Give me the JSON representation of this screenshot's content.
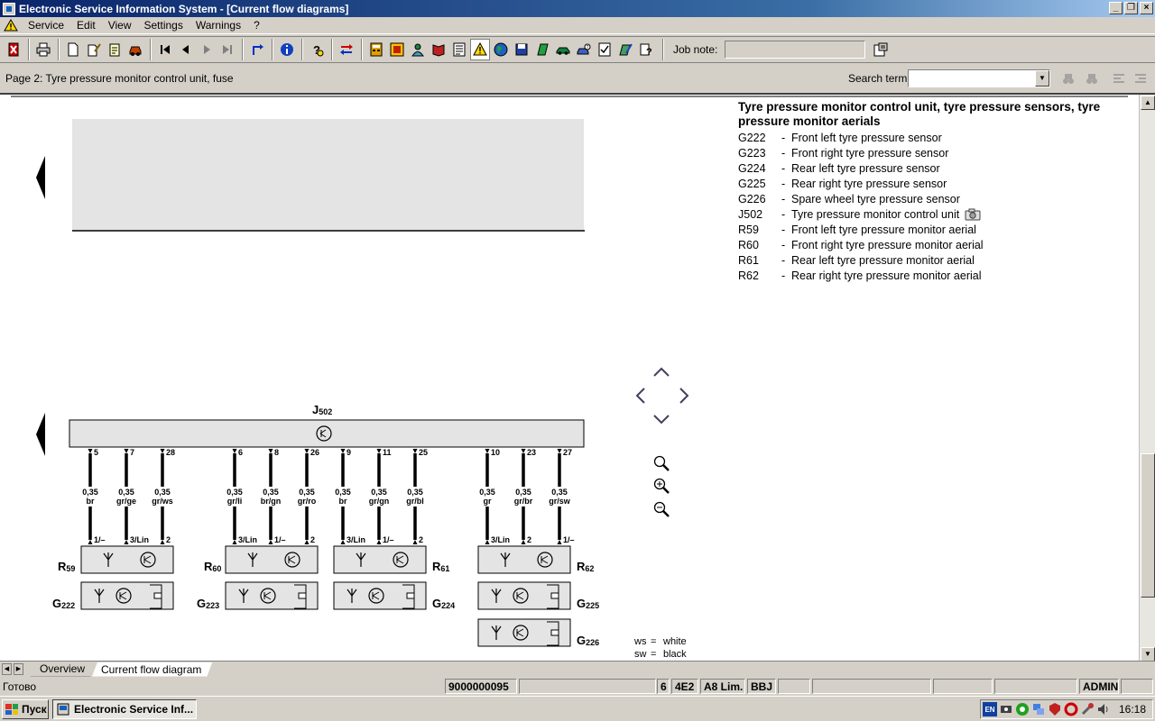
{
  "window": {
    "title": "Electronic Service Information System - [Current flow diagrams]"
  },
  "menu": {
    "items": [
      "Service",
      "Edit",
      "View",
      "Settings",
      "Warnings",
      "?"
    ]
  },
  "toolbar": {
    "job_note_label": "Job note:",
    "job_note_value": ""
  },
  "page": {
    "title": "Page 2: Tyre pressure monitor control unit, fuse",
    "search_label": "Search term:",
    "search_value": ""
  },
  "legend": {
    "title": "Tyre pressure monitor control unit, tyre pressure sensors, tyre pressure monitor aerials",
    "items": [
      {
        "code": "G222",
        "dash": "-",
        "text": "Front left tyre pressure sensor"
      },
      {
        "code": "G223",
        "dash": "-",
        "text": "Front right tyre pressure sensor"
      },
      {
        "code": "G224",
        "dash": "-",
        "text": "Rear left tyre pressure sensor"
      },
      {
        "code": "G225",
        "dash": "-",
        "text": "Rear right tyre pressure sensor"
      },
      {
        "code": "G226",
        "dash": "-",
        "text": "Spare wheel tyre pressure sensor"
      },
      {
        "code": "J502",
        "dash": "-",
        "text": "Tyre pressure monitor control unit"
      },
      {
        "code": "R59",
        "dash": "-",
        "text": "Front left tyre pressure monitor aerial"
      },
      {
        "code": "R60",
        "dash": "-",
        "text": "Front right tyre pressure monitor aerial"
      },
      {
        "code": "R61",
        "dash": "-",
        "text": "Rear left tyre pressure monitor aerial"
      },
      {
        "code": "R62",
        "dash": "-",
        "text": "Rear right tyre pressure monitor aerial"
      }
    ]
  },
  "diagram": {
    "control_unit": {
      "main": "J",
      "sub": "502"
    },
    "wires": [
      {
        "pin_top": "5",
        "size": "0,35",
        "color": "br",
        "pin_bottom": "1/–"
      },
      {
        "pin_top": "7",
        "size": "0,35",
        "color": "gr/ge",
        "pin_bottom": "3/Lin"
      },
      {
        "pin_top": "28",
        "size": "0,35",
        "color": "gr/ws",
        "pin_bottom": "2"
      },
      {
        "pin_top": "6",
        "size": "0,35",
        "color": "gr/li",
        "pin_bottom": "3/Lin"
      },
      {
        "pin_top": "8",
        "size": "0,35",
        "color": "br/gn",
        "pin_bottom": "1/–"
      },
      {
        "pin_top": "26",
        "size": "0,35",
        "color": "gr/ro",
        "pin_bottom": "2"
      },
      {
        "pin_top": "9",
        "size": "0,35",
        "color": "br",
        "pin_bottom": "3/Lin"
      },
      {
        "pin_top": "11",
        "size": "0,35",
        "color": "gr/gn",
        "pin_bottom": "1/–"
      },
      {
        "pin_top": "25",
        "size": "0,35",
        "color": "gr/bl",
        "pin_bottom": "2"
      },
      {
        "pin_top": "10",
        "size": "0,35",
        "color": "gr",
        "pin_bottom": "3/Lin"
      },
      {
        "pin_top": "23",
        "size": "0,35",
        "color": "gr/br",
        "pin_bottom": "2"
      },
      {
        "pin_top": "27",
        "size": "0,35",
        "color": "gr/sw",
        "pin_bottom": "1/–"
      }
    ],
    "aerials": [
      {
        "main": "R",
        "sub": "59"
      },
      {
        "main": "R",
        "sub": "60"
      },
      {
        "main": "R",
        "sub": "61"
      },
      {
        "main": "R",
        "sub": "62"
      }
    ],
    "sensors": [
      {
        "main": "G",
        "sub": "222"
      },
      {
        "main": "G",
        "sub": "223"
      },
      {
        "main": "G",
        "sub": "224"
      },
      {
        "main": "G",
        "sub": "225"
      },
      {
        "main": "G",
        "sub": "226"
      }
    ],
    "abbreviations": [
      {
        "abbr": "ws",
        "eq": "=",
        "meaning": "white"
      },
      {
        "abbr": "sw",
        "eq": "=",
        "meaning": "black"
      }
    ]
  },
  "tabs": [
    {
      "label": "Overview",
      "active": false
    },
    {
      "label": "Current flow diagram",
      "active": true
    }
  ],
  "status": {
    "text": "Готово",
    "order": "9000000095",
    "field_6": "6",
    "model_code": "4E2",
    "model": "A8 Lim.",
    "engine": "BBJ",
    "user": "ADMIN"
  },
  "taskbar": {
    "start_label": "Пуск",
    "task_label": "Electronic Service Inf...",
    "lang": "EN",
    "clock": "16:18"
  },
  "colors": {
    "title_bar": "#0a246a",
    "chrome": "#d4d0c8",
    "diagram_box": "#e4e4e4"
  }
}
